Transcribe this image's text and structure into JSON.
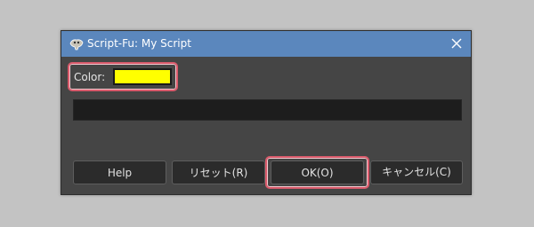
{
  "window": {
    "title": "Script-Fu: My Script",
    "app_icon": "gimp-icon",
    "close_icon": "close-icon"
  },
  "form": {
    "color_label": "Color:",
    "color_value": "#ffff00"
  },
  "buttons": {
    "help": "Help",
    "reset": "リセット(R)",
    "ok": "OK(O)",
    "cancel": "キャンセル(C)"
  },
  "colors": {
    "titlebar": "#5b87bd",
    "dialog_bg": "#454545",
    "highlight": "#d85a6b"
  }
}
